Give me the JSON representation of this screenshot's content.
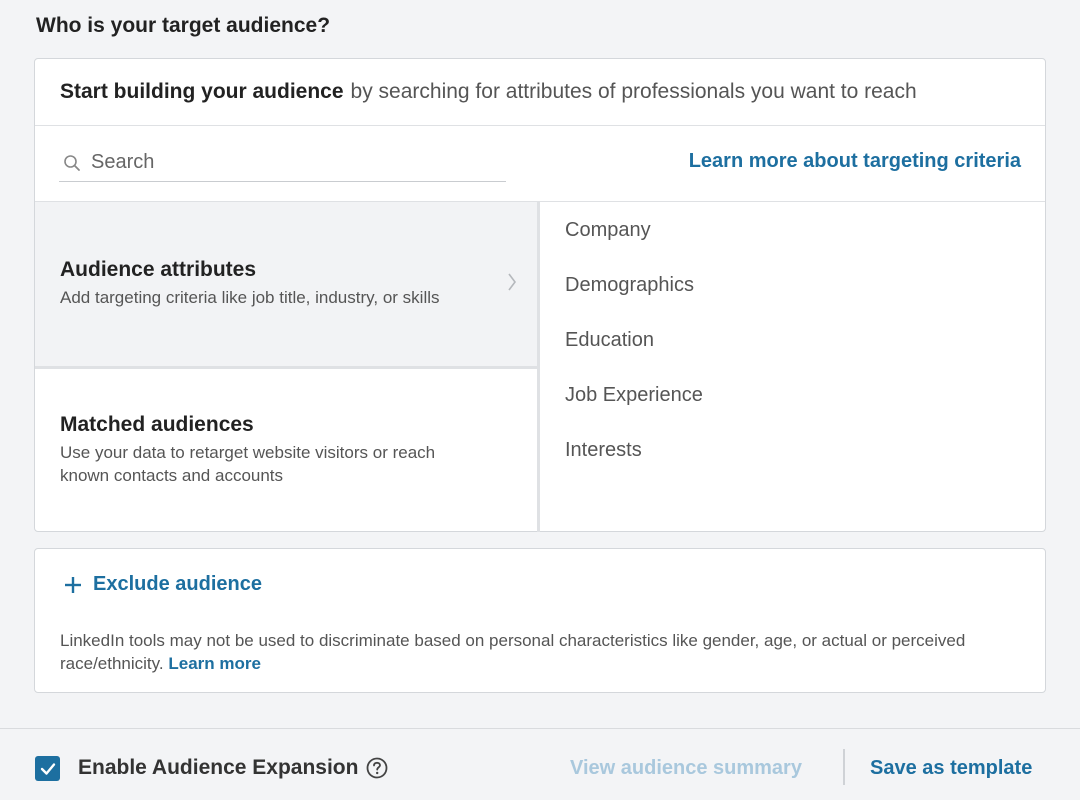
{
  "section": {
    "title": "Who is your target audience?"
  },
  "card": {
    "header_bold": "Start building your audience",
    "header_rest": "by searching for attributes of professionals you want to reach"
  },
  "search": {
    "placeholder": "Search",
    "icon": "search-icon"
  },
  "learn_more_link": "Learn more about targeting criteria",
  "options": [
    {
      "title": "Audience attributes",
      "desc": "Add targeting criteria like job title, industry, or skills",
      "selected": true
    },
    {
      "title": "Matched audiences",
      "desc": "Use your data to retarget website visitors or reach known contacts and accounts",
      "selected": false
    }
  ],
  "categories": [
    "Company",
    "Demographics",
    "Education",
    "Job Experience",
    "Interests"
  ],
  "exclude": {
    "label": "Exclude audience",
    "disclaimer": "LinkedIn tools may not be used to discriminate based on personal characteristics like gender, age, or actual or perceived race/ethnicity.",
    "learn_more": "Learn more"
  },
  "footer": {
    "expansion_label": "Enable Audience Expansion",
    "expansion_checked": true,
    "view_summary": "View audience summary",
    "save_template": "Save as template"
  },
  "colors": {
    "accent": "#1d6fa0",
    "disabled_link": "#a9c8dd",
    "background": "#f3f4f6"
  }
}
